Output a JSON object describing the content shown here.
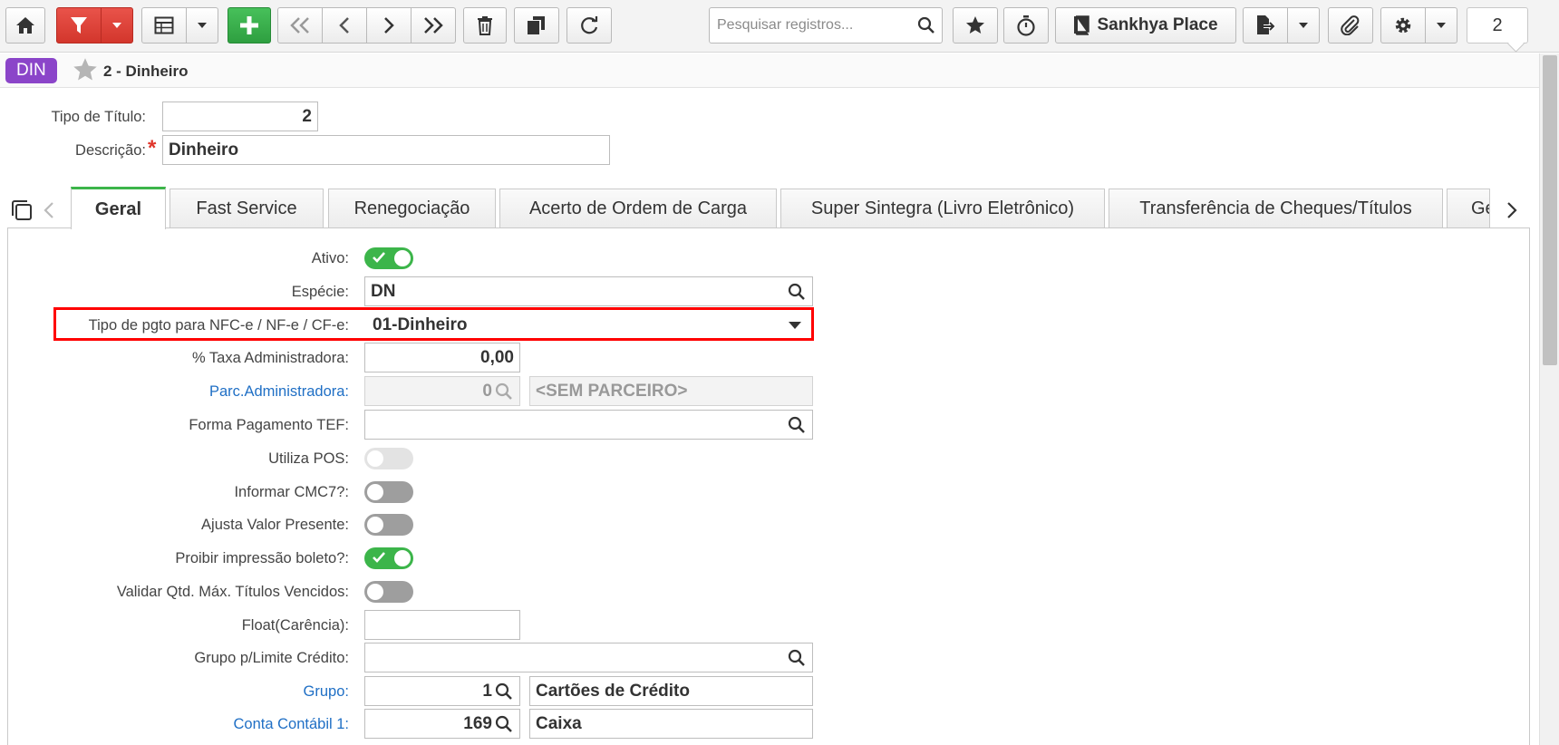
{
  "toolbar": {
    "search_placeholder": "Pesquisar registros...",
    "place_label": "Sankhya Place",
    "page_number": "2"
  },
  "record": {
    "badge": "DIN",
    "title": "2 - Dinheiro"
  },
  "header_form": {
    "tipo_titulo_label": "Tipo de Título:",
    "tipo_titulo_value": "2",
    "descricao_label": "Descrição:",
    "descricao_value": "Dinheiro"
  },
  "tabs": [
    {
      "label": "Geral",
      "active": true
    },
    {
      "label": "Fast Service"
    },
    {
      "label": "Renegociação"
    },
    {
      "label": "Acerto de Ordem de Carga"
    },
    {
      "label": "Super Sintegra (Livro Eletrônico)"
    },
    {
      "label": "Transferência de Cheques/Títulos"
    },
    {
      "label": "Ge"
    }
  ],
  "form": {
    "ativo_label": "Ativo:",
    "ativo_on": true,
    "especie_label": "Espécie:",
    "especie_value": "DN",
    "tipo_pgto_label": "Tipo de pgto para NFC-e / NF-e / CF-e:",
    "tipo_pgto_value": "01-Dinheiro",
    "taxa_label": "% Taxa Administradora:",
    "taxa_value": "0,00",
    "parc_label": "Parc.Administradora:",
    "parc_code": "0",
    "parc_name": "<SEM PARCEIRO>",
    "forma_tef_label": "Forma Pagamento TEF:",
    "forma_tef_value": "",
    "utiliza_pos_label": "Utiliza POS:",
    "cmc7_label": "Informar CMC7?:",
    "ajusta_label": "Ajusta Valor Presente:",
    "proibir_label": "Proibir impressão boleto?:",
    "validar_label": "Validar Qtd. Máx. Títulos Vencidos:",
    "float_label": "Float(Carência):",
    "float_value": "",
    "grupo_limite_label": "Grupo p/Limite Crédito:",
    "grupo_limite_value": "",
    "grupo_label": "Grupo:",
    "grupo_code": "1",
    "grupo_name": "Cartões de Crédito",
    "conta_label": "Conta Contábil 1:",
    "conta_code": "169",
    "conta_name": "Caixa"
  },
  "colors": {
    "accent_green": "#3cb54a",
    "filter_red": "#d3362c",
    "badge_purple": "#8b45c9",
    "link_blue": "#1f6fc5",
    "highlight_red": "#ff0000"
  }
}
